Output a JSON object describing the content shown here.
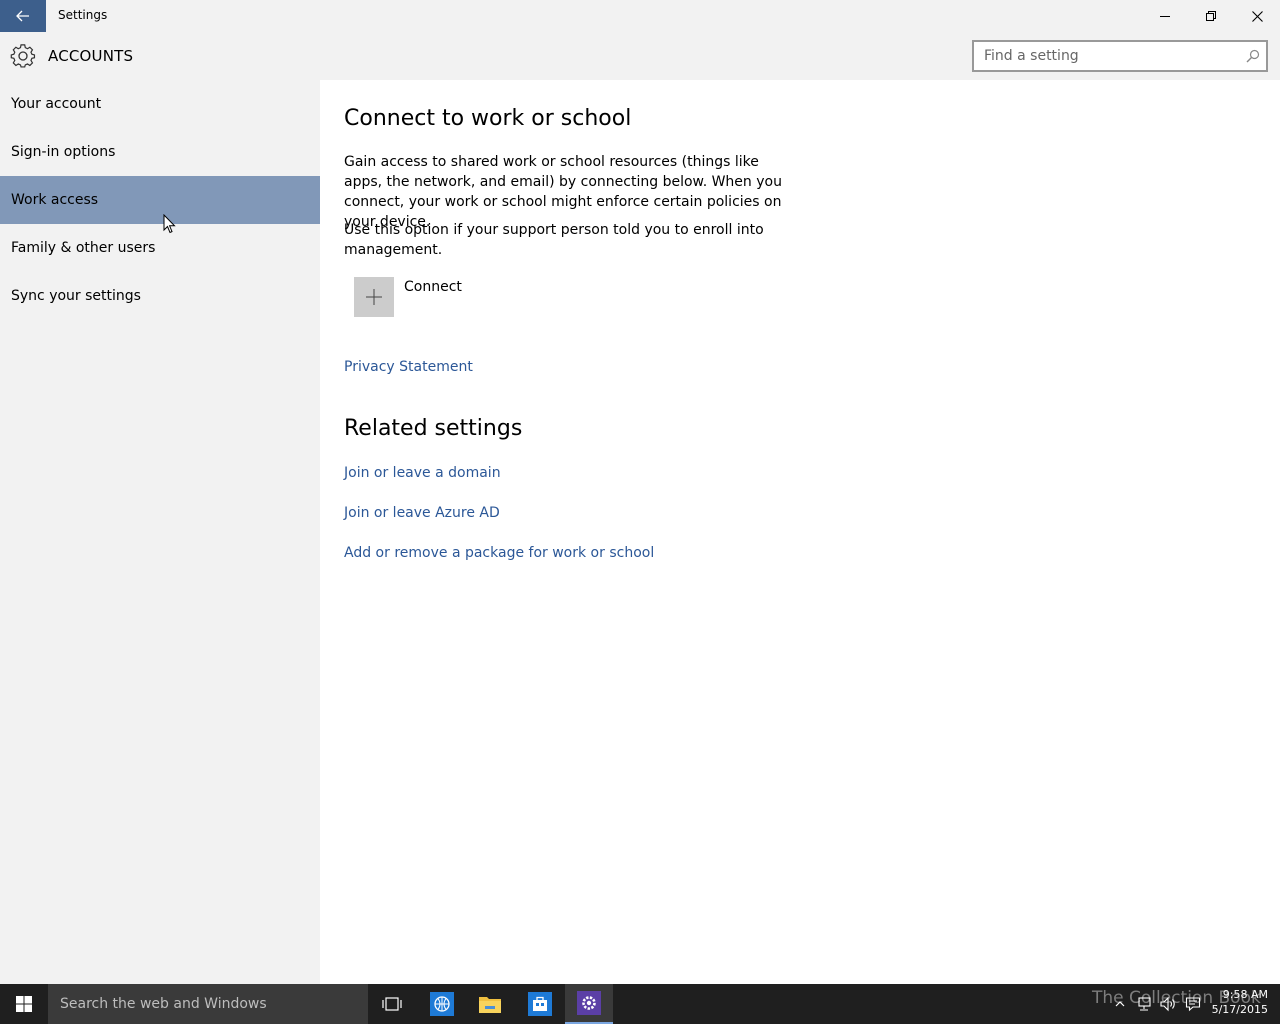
{
  "window": {
    "title": "Settings"
  },
  "header": {
    "section_title": "ACCOUNTS",
    "search_placeholder": "Find a setting"
  },
  "sidebar": {
    "items": [
      {
        "label": "Your account",
        "selected": false
      },
      {
        "label": "Sign-in options",
        "selected": false
      },
      {
        "label": "Work access",
        "selected": true
      },
      {
        "label": "Family & other users",
        "selected": false
      },
      {
        "label": "Sync your settings",
        "selected": false
      }
    ]
  },
  "main": {
    "title": "Connect to work or school",
    "description": "Gain access to shared work or school resources (things like apps, the network, and email) by connecting below. When you connect, your work or school might enforce certain policies on your device.",
    "enroll_text": "Use this option if your support person told you to enroll into management.",
    "connect_label": "Connect",
    "privacy_link": "Privacy Statement",
    "related_title": "Related settings",
    "related_links": [
      "Join or leave a domain",
      "Join or leave Azure AD",
      "Add or remove a package for work or school"
    ]
  },
  "taskbar": {
    "search_text": "Search the web and Windows",
    "watermark": "The Collection Book",
    "time": "9:58 AM",
    "date": "5/17/2015"
  },
  "colors": {
    "accent": "#3d5f8c",
    "selected_nav": "#8198b8",
    "link": "#2b5797"
  }
}
